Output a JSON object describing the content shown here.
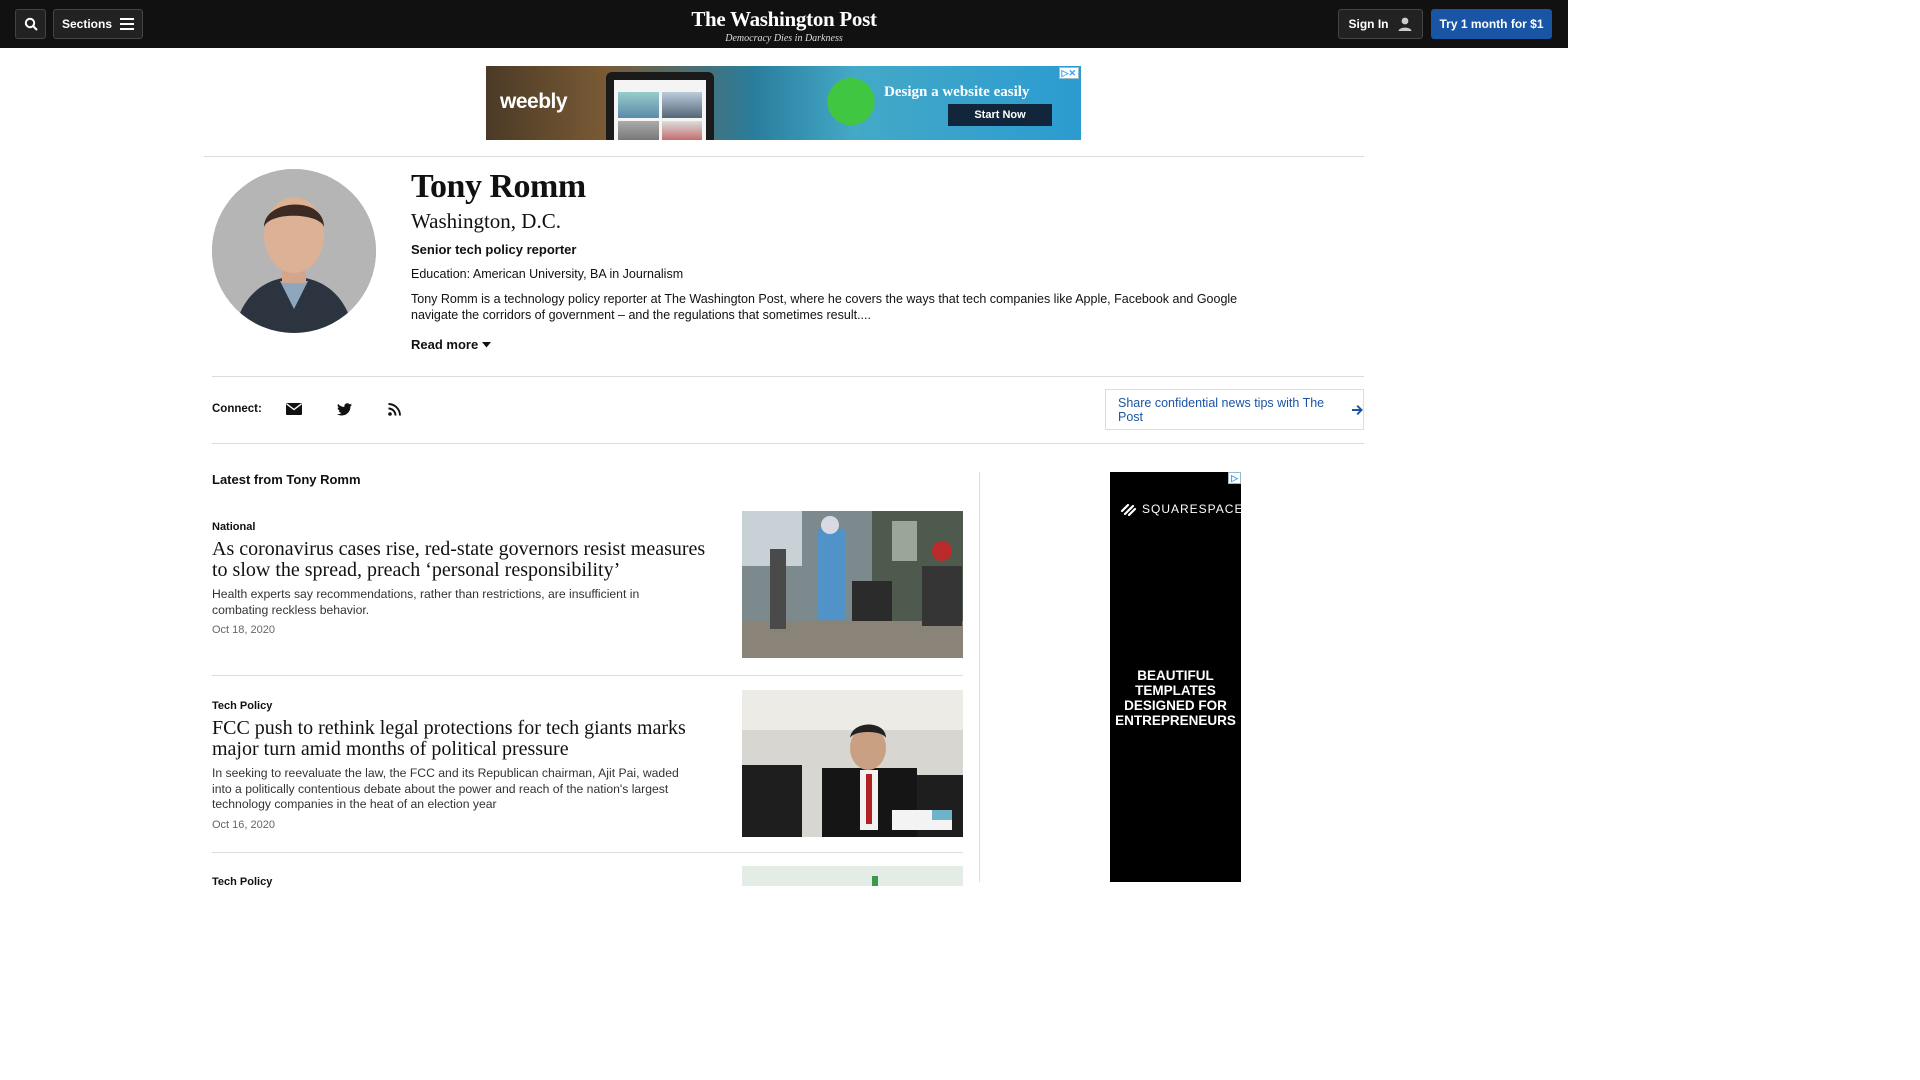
{
  "header": {
    "search_icon": "search-icon",
    "sections_label": "Sections",
    "logo_name": "The Washington Post",
    "logo_tagline": "Democracy Dies in Darkness",
    "signin_label": "Sign In",
    "trial_label": "Try 1 month for $1"
  },
  "banner_ad": {
    "brand": "weebly",
    "headline": "Design a website easily",
    "cta": "Start Now"
  },
  "profile": {
    "name": "Tony Romm",
    "location": "Washington, D.C.",
    "role": "Senior tech policy reporter",
    "education": "Education: American University, BA in Journalism",
    "bio": "Tony Romm is a technology policy reporter at The Washington Post, where he covers the ways that tech companies like Apple, Facebook and Google navigate the corridors of government – and the regulations that sometimes result....",
    "read_more": "Read more"
  },
  "connect": {
    "label": "Connect:",
    "icons": [
      "email-icon",
      "twitter-icon",
      "rss-icon"
    ],
    "tips_label": "Share confidential news tips with The Post"
  },
  "latest": {
    "heading": "Latest from Tony Romm",
    "articles": [
      {
        "kicker": "National",
        "headline": "As coronavirus cases rise, red-state governors resist measures to slow the spread, preach ‘personal responsibility’",
        "blurb": "Health experts say recommendations, rather than restrictions, are insufficient in combating reckless behavior.",
        "date": "Oct 18, 2020"
      },
      {
        "kicker": "Tech Policy",
        "headline": "FCC push to rethink legal protections for tech giants marks major turn amid months of political pressure",
        "blurb": "In seeking to reevaluate the law, the FCC and its Republican chairman, Ajit Pai, waded into a politically contentious debate about the power and reach of the nation's largest technology companies in the heat of an election year",
        "date": "Oct 16, 2020"
      },
      {
        "kicker": "Tech Policy"
      }
    ]
  },
  "side_ad": {
    "brand": "SQUARESPACE",
    "copy": "BEAUTIFUL TEMPLATES DESIGNED FOR ENTREPRENEURS"
  },
  "colors": {
    "topbar": "#111111",
    "accent_blue": "#1955a5"
  }
}
